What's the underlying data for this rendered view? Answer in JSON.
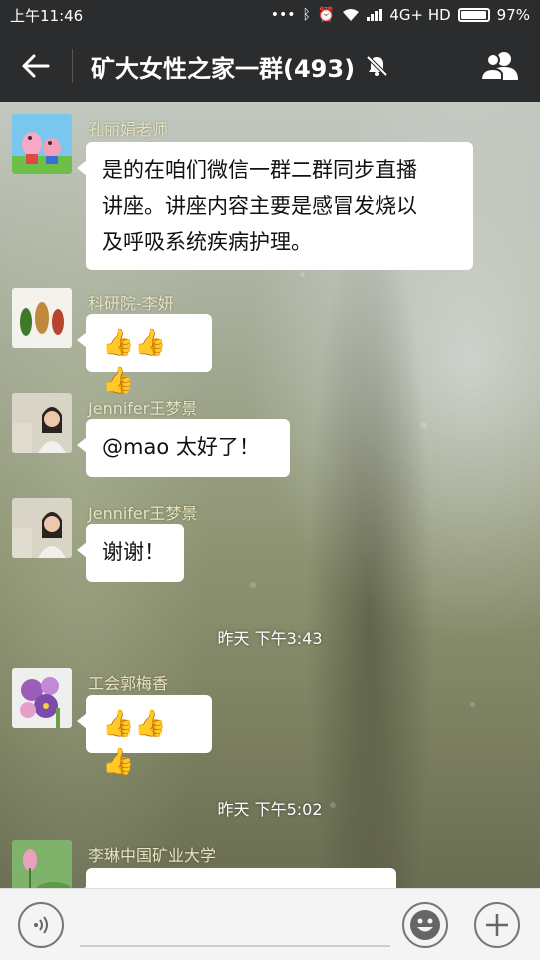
{
  "status_bar": {
    "time": "上午11:46",
    "network": "4G+ HD",
    "battery": "97%",
    "icons": [
      "more-dots-icon",
      "bluetooth-icon",
      "alarm-icon",
      "wifi-icon",
      "signal-icon",
      "battery-icon"
    ]
  },
  "header": {
    "title": "矿大女性之家一群(493)",
    "back_icon": "back-arrow-icon",
    "mute_icon": "bell-off-icon",
    "members_icon": "members-icon"
  },
  "messages": [
    {
      "sender": "孔丽娟老师",
      "text": [
        "是的在咱们微信一群二群同步直播",
        "讲座。讲座内容主要是感冒发烧以",
        "及呼吸系统疾病护理。"
      ]
    },
    {
      "sender": "科研院-李妍",
      "text": [
        "👍👍👍"
      ]
    },
    {
      "sender": "Jennifer王梦景",
      "text": [
        "@mao  太好了！"
      ]
    },
    {
      "sender": "Jennifer王梦景",
      "text": [
        "谢谢！"
      ]
    },
    {
      "sender": "工会郭梅香",
      "text": [
        "👍👍👍"
      ]
    },
    {
      "sender": "李琳中国矿业大学",
      "text": [
        ""
      ]
    }
  ],
  "timestamps": [
    "昨天  下午3:43",
    "昨天  下午5:02"
  ],
  "input_bar": {
    "voice_icon": "voice-icon",
    "emoji_icon": "emoji-icon",
    "plus_icon": "plus-icon"
  }
}
